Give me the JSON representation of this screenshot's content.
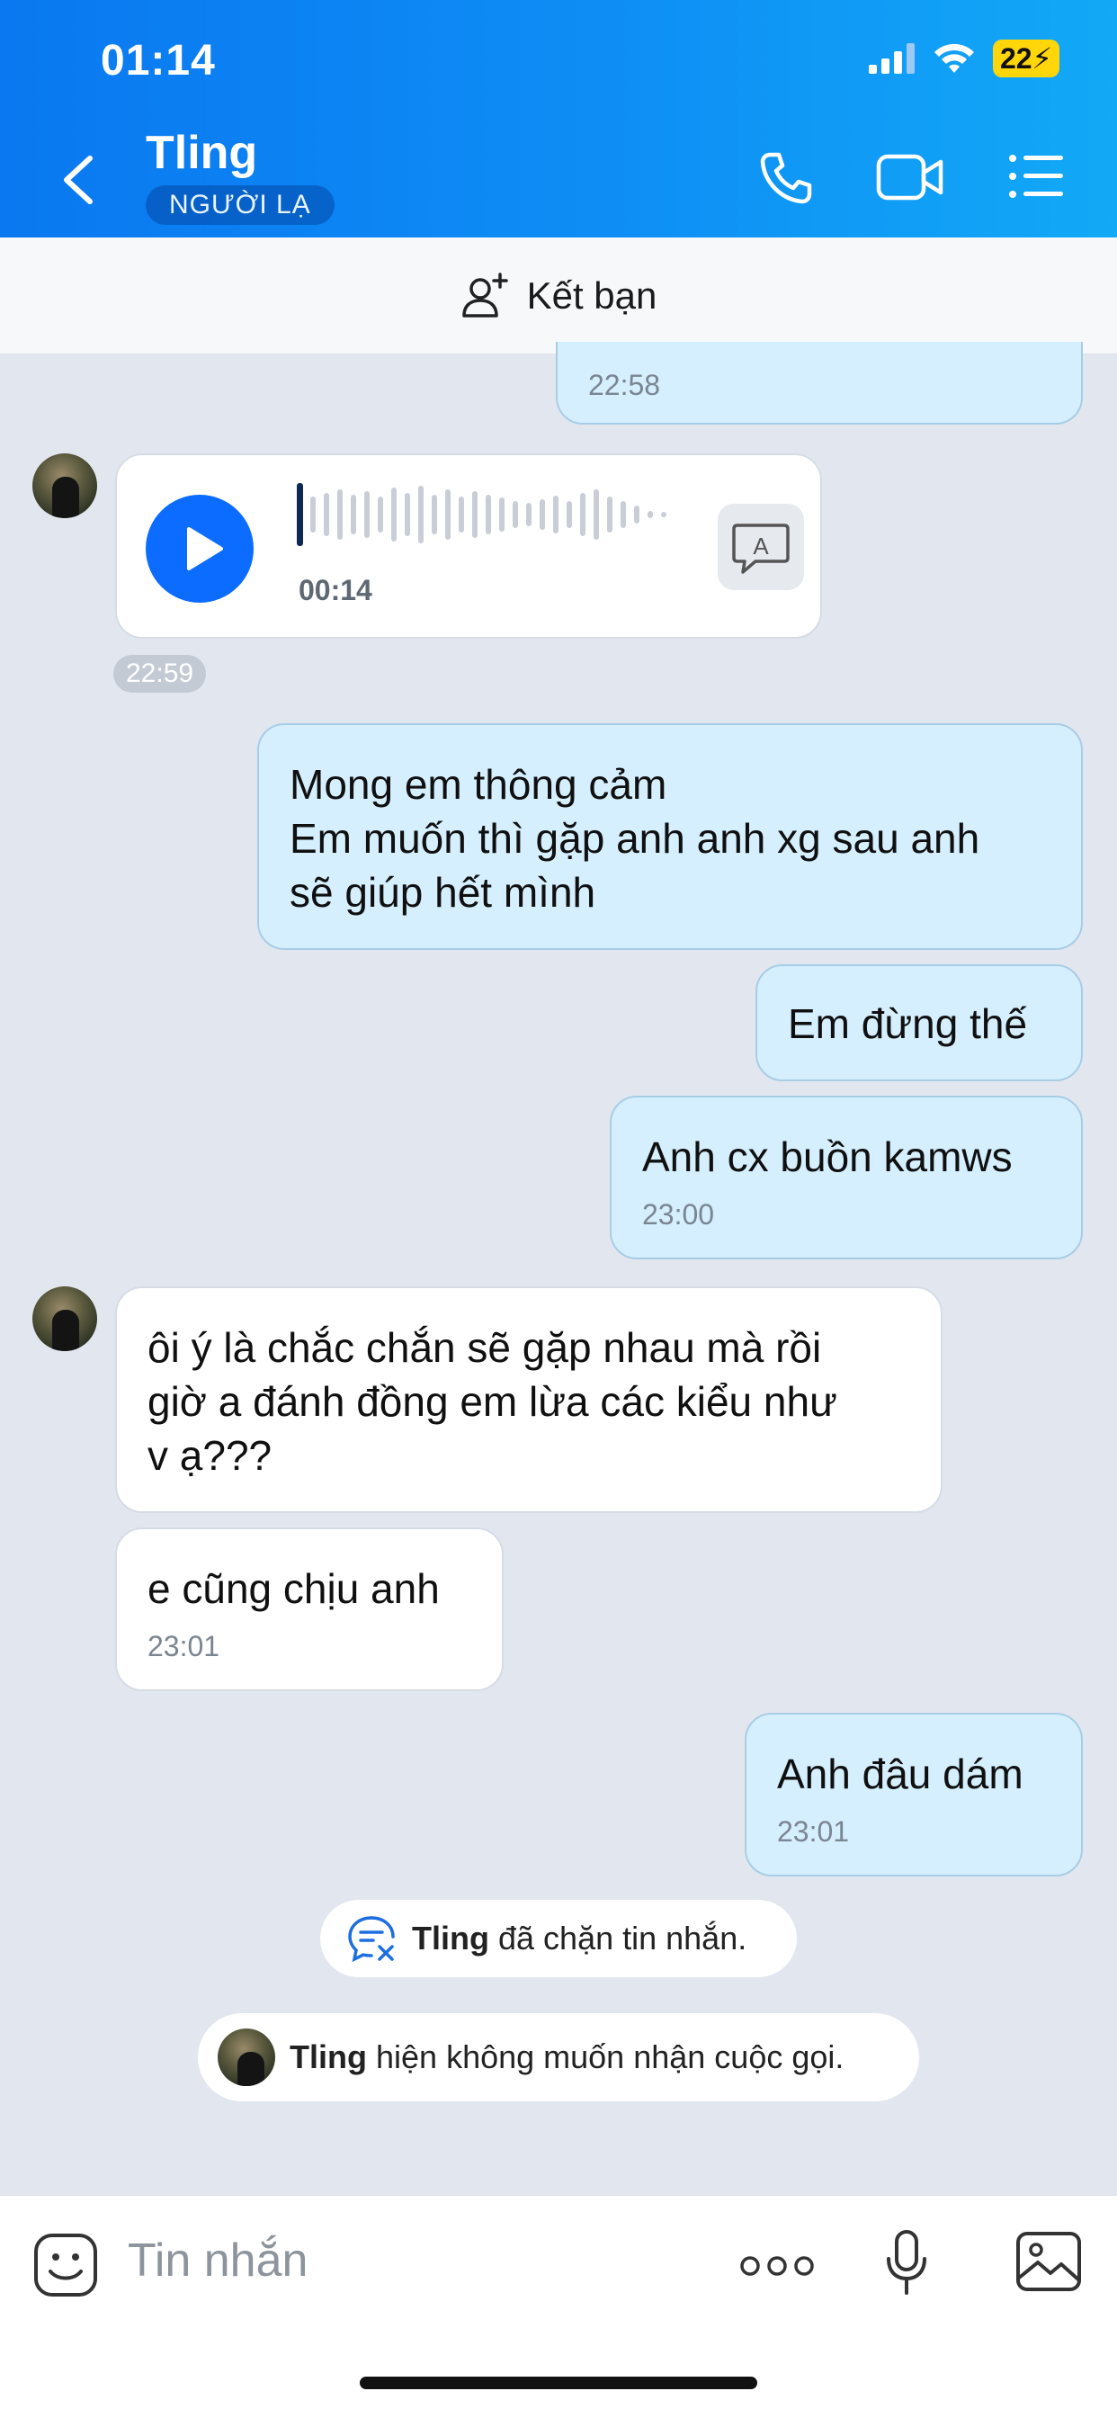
{
  "status_bar": {
    "time": "01:14",
    "battery": "22"
  },
  "header": {
    "title": "Tling",
    "badge": "NGƯỜI LẠ"
  },
  "friend_bar": {
    "label": "Kết bạn"
  },
  "messages": {
    "partial_time": "22:58",
    "voice": {
      "duration": "00:14",
      "time": "22:59"
    },
    "out1": {
      "lines": [
        "Mong em thông cảm",
        "Em muốn thì gặp anh anh xg sau anh",
        "sẽ giúp hết mình"
      ]
    },
    "out2": {
      "text": "Em đừng thế"
    },
    "out3": {
      "text": "Anh cx buồn kamws",
      "time": "23:00"
    },
    "in1": {
      "lines": [
        "ôi ý là chắc chắn sẽ gặp nhau mà rồi",
        "giờ a đánh đồng em lừa các kiểu như",
        "v ạ???"
      ]
    },
    "in2": {
      "text": "e cũng chịu anh",
      "time": "23:01"
    },
    "out4": {
      "text": "Anh đâu dám",
      "time": "23:01"
    }
  },
  "notices": {
    "blocked": {
      "name": "Tling",
      "text": "đã chặn tin nhắn."
    },
    "no_calls": {
      "name": "Tling",
      "text": "hiện không muốn nhận cuộc gọi."
    }
  },
  "input": {
    "placeholder": "Tin nhắn"
  },
  "colors": {
    "header_start": "#0a78f0",
    "header_end": "#12a9f6",
    "accent": "#0b6cff",
    "out_bubble": "#d5efff"
  }
}
